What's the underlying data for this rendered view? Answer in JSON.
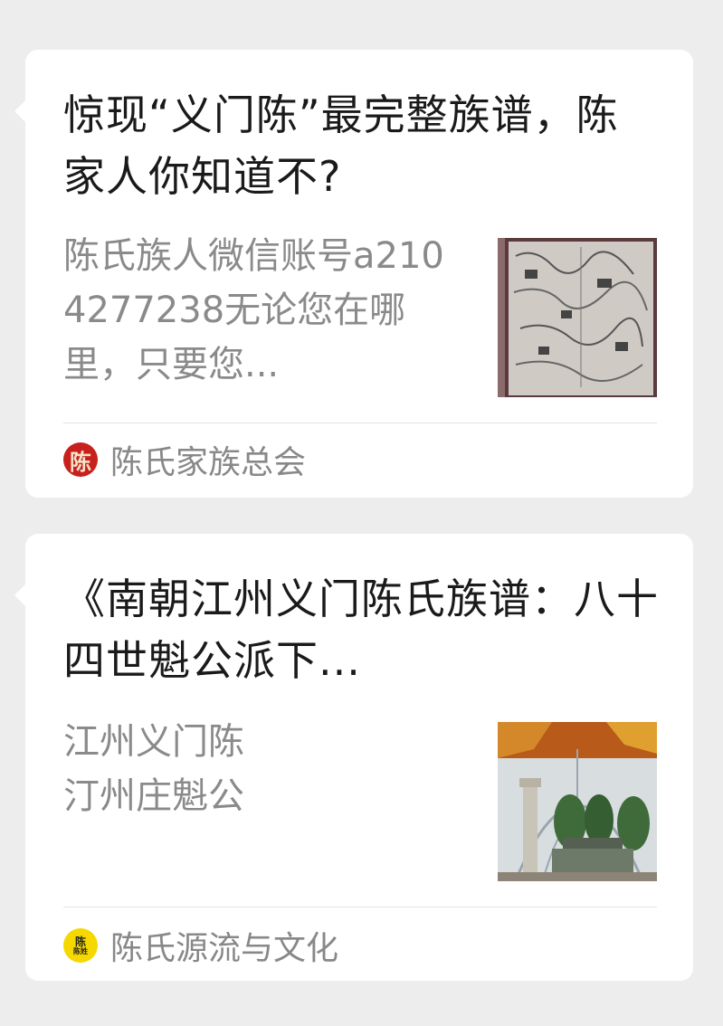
{
  "articles": [
    {
      "title": "惊现“义门陈”最完整族谱，陈家人你知道不?",
      "description": "陈氏族人微信账号a2104277238无论您在哪里，只要您...",
      "source": "陈氏家族总会",
      "avatar_text": "陈",
      "thumbnail": "genealogy-map-image"
    },
    {
      "title": "《南朝江州义门陈氏族谱：八十四世魁公派下...",
      "description_lines": [
        "江州义门陈",
        "汀州庄魁公"
      ],
      "source": "陈氏源流与文化",
      "avatar_text_top": "陈",
      "avatar_text_bottom": "陈姓",
      "thumbnail": "memorial-monument-image"
    }
  ],
  "colors": {
    "background": "#ededed",
    "card": "#ffffff",
    "title_text": "#1a1a1a",
    "secondary_text": "#8a8a8a",
    "avatar_red": "#c8201c",
    "avatar_yellow": "#f5d800"
  }
}
